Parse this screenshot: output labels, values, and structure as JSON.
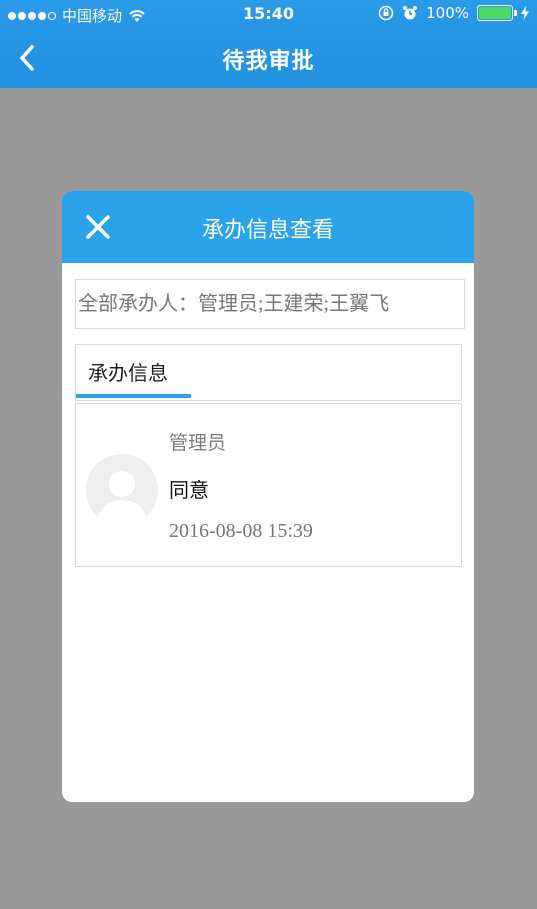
{
  "status_bar": {
    "carrier": "中国移动",
    "time": "15:40",
    "battery_percent": "100%",
    "battery_level": 1.0,
    "signal_bars_filled": 4,
    "signal_bars_total": 5
  },
  "navbar": {
    "title": "待我审批",
    "back_icon": "chevron-left-icon"
  },
  "modal": {
    "title": "承办信息查看",
    "close_icon": "close-icon",
    "all_handlers_label": "全部承办人：",
    "all_handlers_value": "管理员;王建荣;王翼飞",
    "tab_label": "承办信息",
    "records": [
      {
        "name": "管理员",
        "opinion": "同意",
        "time": "2016-08-08 15:39",
        "avatar_icon": "default-avatar-icon"
      }
    ]
  },
  "colors": {
    "primary_blue": "#2aa3ea",
    "overlay_gray": "#999999",
    "battery_green": "#4cd964"
  }
}
